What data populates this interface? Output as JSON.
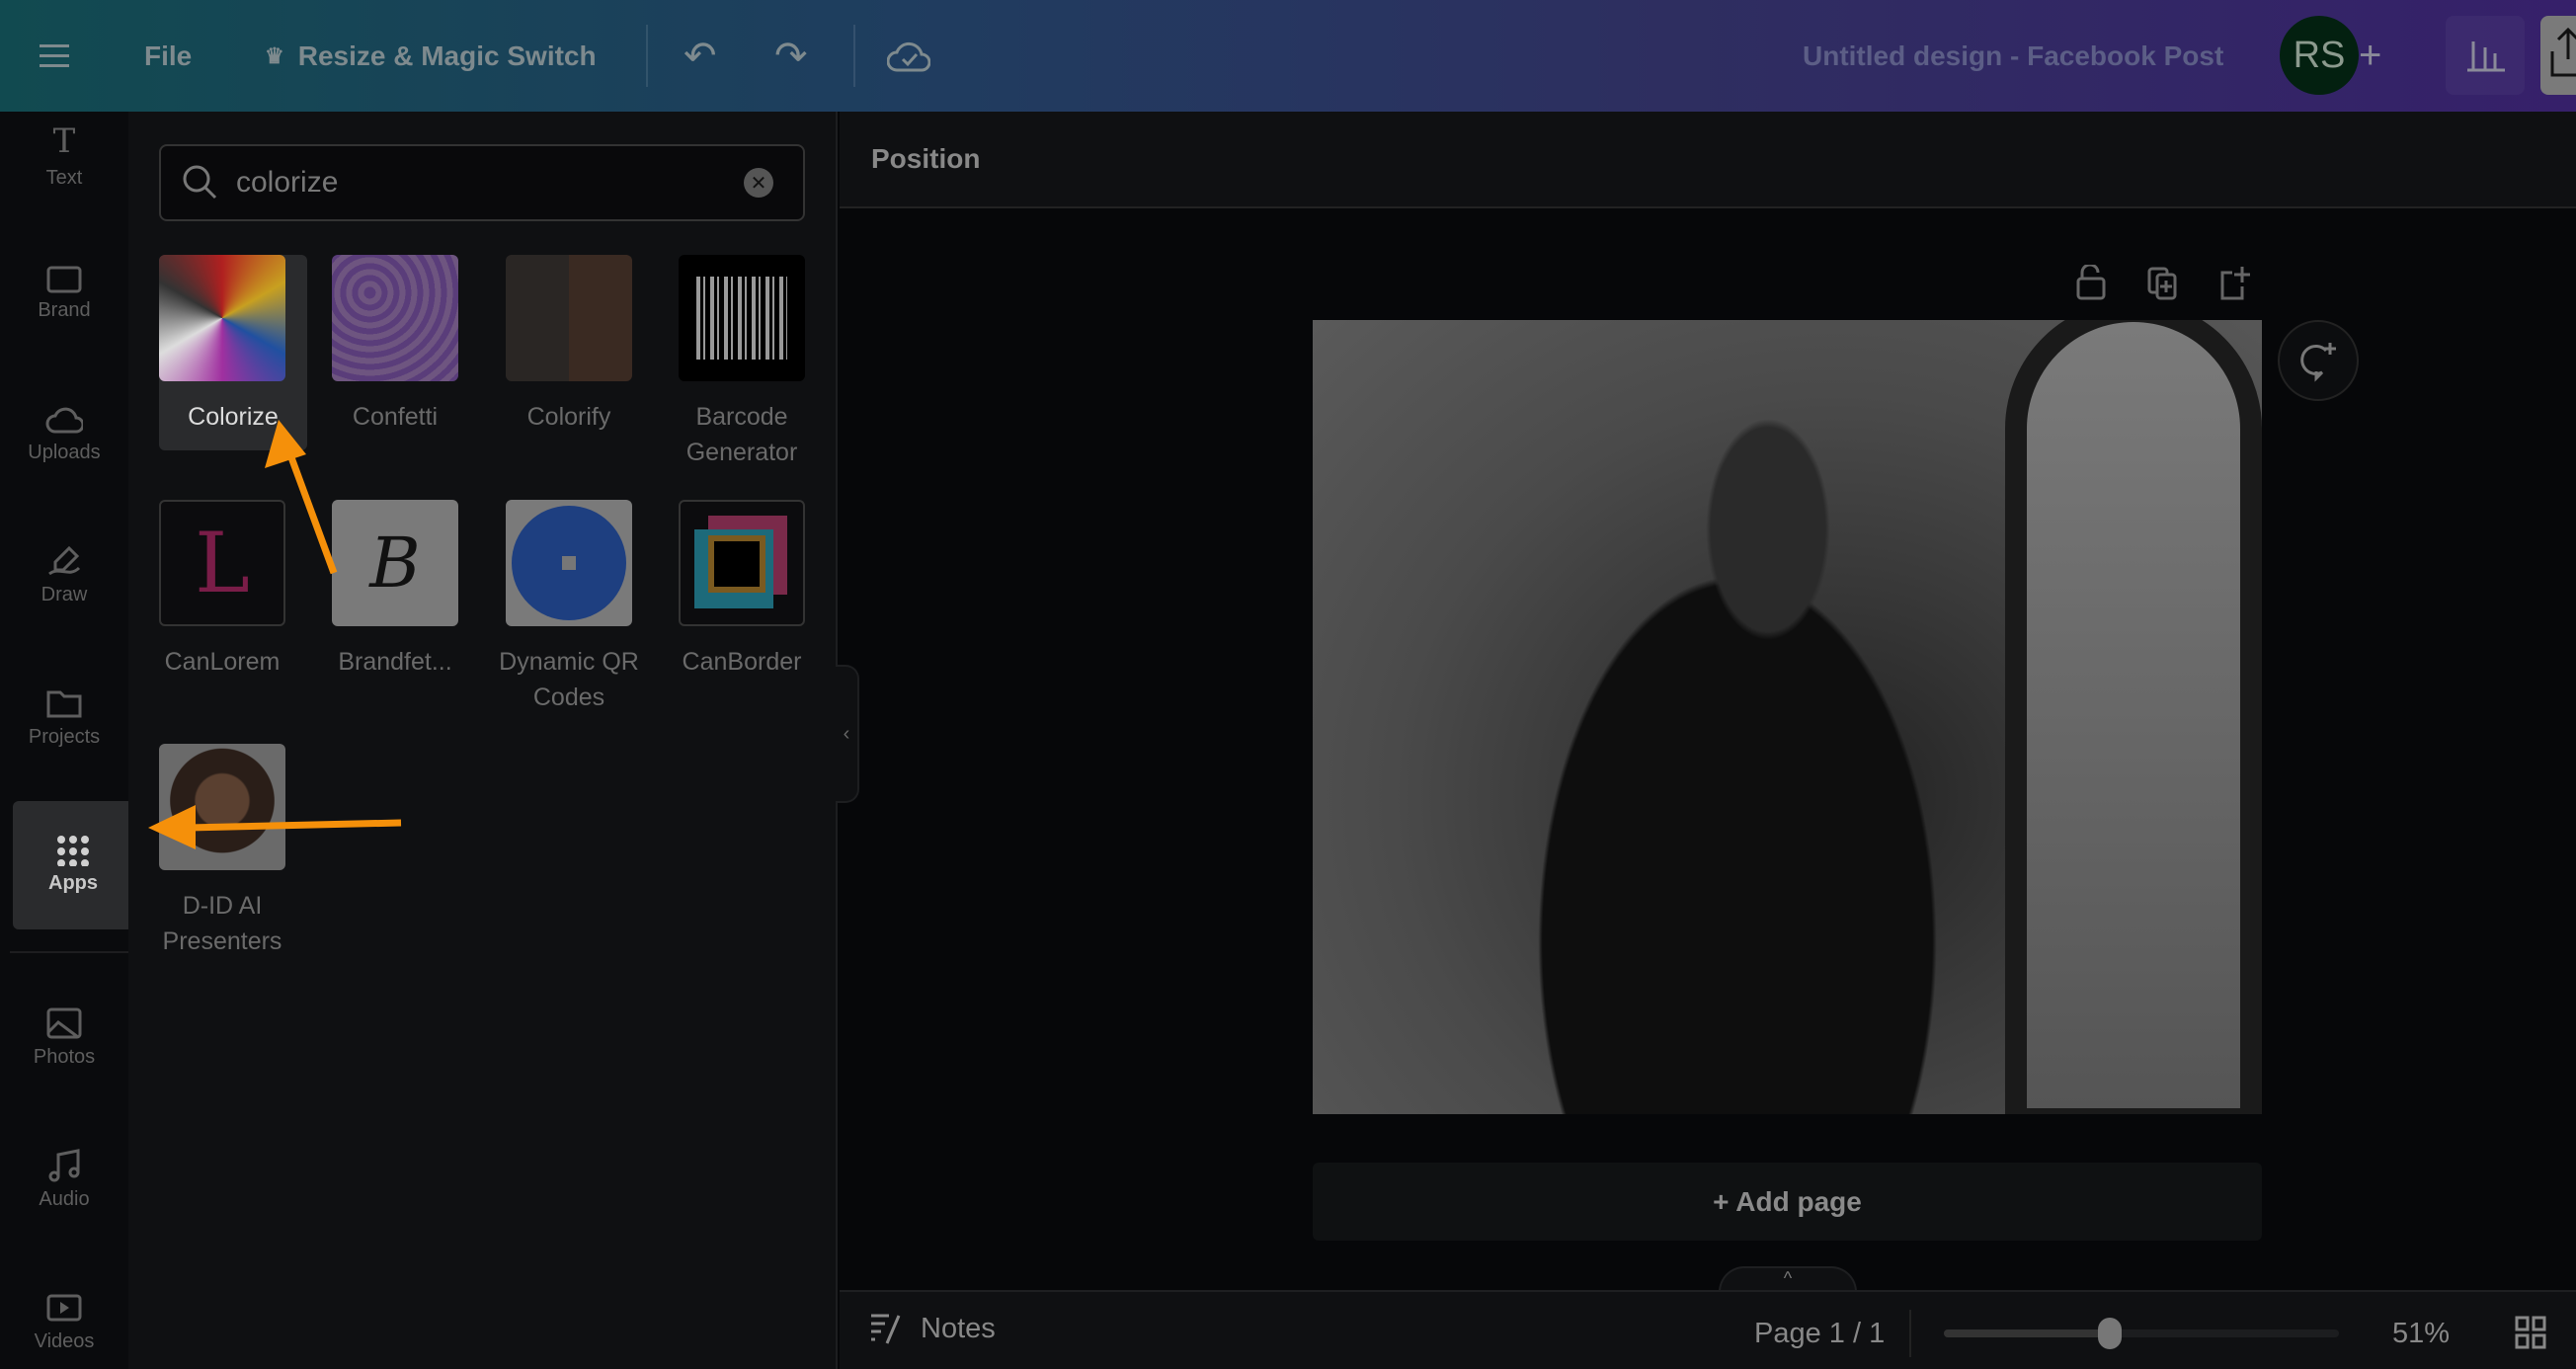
{
  "topbar": {
    "menu_icon": "hamburger-icon",
    "file": "File",
    "resize": "Resize & Magic Switch",
    "design_title": "Untitled design - Facebook Post",
    "avatar_initials": "RS",
    "colors": {
      "gradient_start": "#114a50",
      "gradient_end": "#36206a",
      "avatar": "#032010"
    }
  },
  "nav": {
    "items": [
      {
        "label": "Text"
      },
      {
        "label": "Brand"
      },
      {
        "label": "Uploads"
      },
      {
        "label": "Draw"
      },
      {
        "label": "Projects"
      },
      {
        "label": "Apps"
      },
      {
        "label": "Photos"
      },
      {
        "label": "Audio"
      },
      {
        "label": "Videos"
      }
    ]
  },
  "search": {
    "value": "colorize"
  },
  "apps": [
    {
      "label": "Colorize"
    },
    {
      "label": "Confetti"
    },
    {
      "label": "Colorify"
    },
    {
      "label": "Barcode Generator"
    },
    {
      "label": "CanLorem"
    },
    {
      "label": "Brandfet..."
    },
    {
      "label": "Dynamic QR Codes"
    },
    {
      "label": "CanBorder"
    },
    {
      "label": "D-ID AI Presenters"
    }
  ],
  "main": {
    "position": "Position",
    "add_page": "+ Add page"
  },
  "footer": {
    "notes": "Notes",
    "page": "Page 1 / 1",
    "zoom": "51%",
    "zoom_percent": 51
  },
  "annotation": {
    "arrow_color": "#f5900a"
  }
}
